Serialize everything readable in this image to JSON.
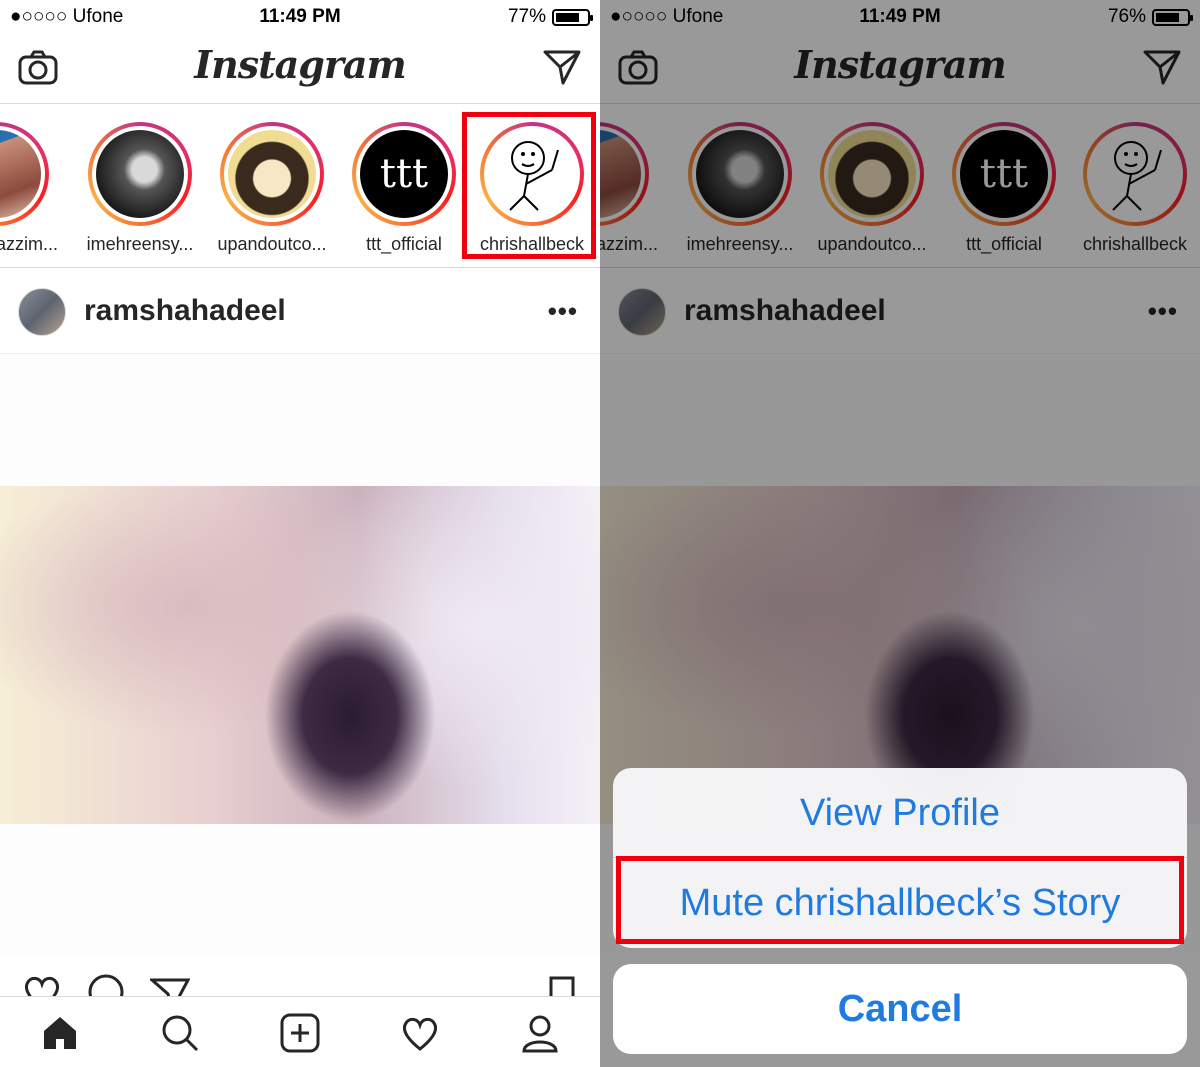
{
  "left": {
    "status": {
      "carrier": "●○○○○ Ufone",
      "time": "11:49 PM",
      "battery_pct": "77%",
      "battery_level": 0.77
    },
    "header": {
      "logo": "Instagram"
    },
    "stories": [
      "razzim...",
      "imehreensy...",
      "upandoutco...",
      "ttt_official",
      "chrishallbeck"
    ],
    "post": {
      "username": "ramshahadeel",
      "more": "•••"
    }
  },
  "right": {
    "status": {
      "carrier": "●○○○○ Ufone",
      "time": "11:49 PM",
      "battery_pct": "76%",
      "battery_level": 0.76
    },
    "header": {
      "logo": "Instagram"
    },
    "stories": [
      "azzim...",
      "imehreensy...",
      "upandoutco...",
      "ttt_official",
      "chrishallbeck"
    ],
    "post": {
      "username": "ramshahadeel",
      "more": "•••"
    },
    "sheet": {
      "view_profile": "View Profile",
      "mute": "Mute chrishallbeck’s Story",
      "cancel": "Cancel"
    }
  },
  "colors": {
    "highlight": "#f0000f",
    "ios_blue": "#1f7be0",
    "text": "#262626"
  }
}
